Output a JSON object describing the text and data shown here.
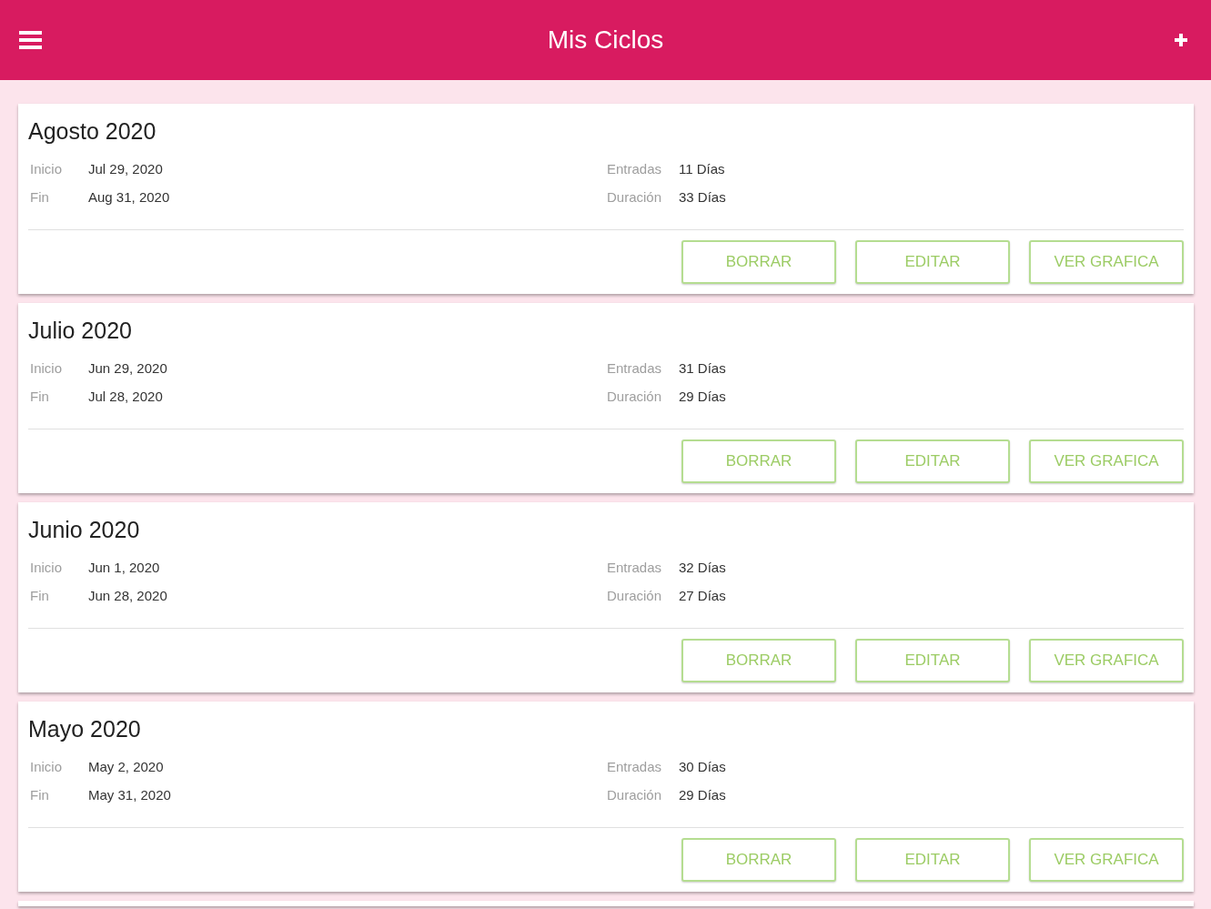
{
  "header": {
    "title": "Mis Ciclos"
  },
  "cycles": [
    {
      "title": "Agosto 2020",
      "fields": [
        {
          "label": "Inicio",
          "value": "Jul 29, 2020"
        },
        {
          "label": "Entradas",
          "value": "11 Días"
        },
        {
          "label": "Fin",
          "value": "Aug 31, 2020"
        },
        {
          "label": "Duración",
          "value": "33 Días"
        }
      ],
      "buttons": [
        "BORRAR",
        "EDITAR",
        "VER GRAFICA"
      ]
    },
    {
      "title": "Julio 2020",
      "fields": [
        {
          "label": "Inicio",
          "value": "Jun 29, 2020"
        },
        {
          "label": "Entradas",
          "value": "31 Días"
        },
        {
          "label": "Fin",
          "value": "Jul 28, 2020"
        },
        {
          "label": "Duración",
          "value": "29 Días"
        }
      ],
      "buttons": [
        "BORRAR",
        "EDITAR",
        "VER GRAFICA"
      ]
    },
    {
      "title": "Junio 2020",
      "fields": [
        {
          "label": "Inicio",
          "value": "Jun 1, 2020"
        },
        {
          "label": "Entradas",
          "value": "32 Días"
        },
        {
          "label": "Fin",
          "value": "Jun 28, 2020"
        },
        {
          "label": "Duración",
          "value": "27 Días"
        }
      ],
      "buttons": [
        "BORRAR",
        "EDITAR",
        "VER GRAFICA"
      ]
    },
    {
      "title": "Mayo 2020",
      "fields": [
        {
          "label": "Inicio",
          "value": "May 2, 2020"
        },
        {
          "label": "Entradas",
          "value": "30 Días"
        },
        {
          "label": "Fin",
          "value": "May 31, 2020"
        },
        {
          "label": "Duración",
          "value": "29 Días"
        }
      ],
      "buttons": [
        "BORRAR",
        "EDITAR",
        "VER GRAFICA"
      ]
    }
  ]
}
